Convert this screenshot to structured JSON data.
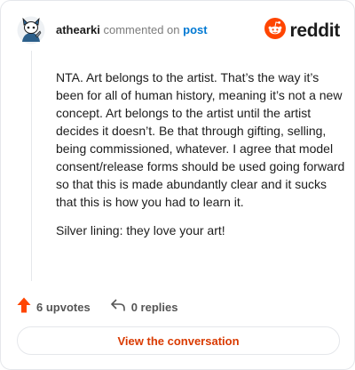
{
  "header": {
    "username": "athearki",
    "action": "commented on",
    "link_text": "post",
    "brand": "reddit",
    "avatar_icon": "snoo-avatar-icon",
    "brand_icon": "reddit-logo-icon",
    "brand_color": "#ff4500"
  },
  "comment": {
    "paragraphs": [
      "NTA. Art belongs to the artist. That’s the way it’s been for all of human history, meaning it’s not a new concept. Art belongs to the artist until the artist decides it doesn’t. Be that through gifting, selling, being commissioned, whatever. I agree that model consent/release forms should be used going forward so that this is made abundantly clear and it sucks that this is how you had to learn it.",
      "Silver lining: they love your art!"
    ]
  },
  "actions": {
    "upvotes": "6 upvotes",
    "replies": "0 replies",
    "upvote_icon": "upvote-arrow-icon",
    "reply_icon": "reply-icon",
    "upvote_color": "#ff4500"
  },
  "cta": {
    "label": "View the conversation"
  }
}
